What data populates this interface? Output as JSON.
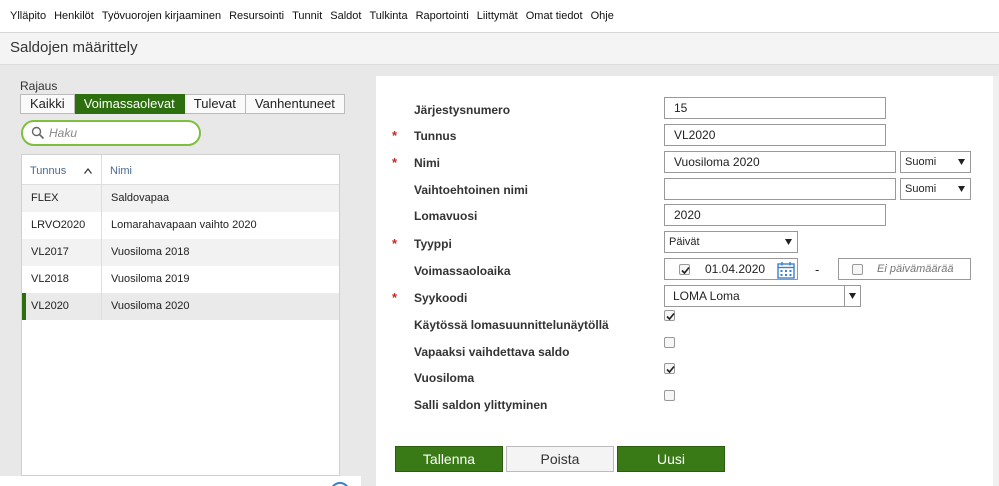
{
  "nav": [
    "Ylläpito",
    "Henkilöt",
    "Työvuorojen kirjaaminen",
    "Resursointi",
    "Tunnit",
    "Saldot",
    "Tulkinta",
    "Raportointi",
    "Liittymät",
    "Omat tiedot",
    "Ohje"
  ],
  "page": {
    "title": "Saldojen määrittely"
  },
  "filter": {
    "label": "Rajaus",
    "tabs": [
      "Kaikki",
      "Voimassaolevat",
      "Tulevat",
      "Vanhentuneet"
    ],
    "active_tab": "Voimassaolevat",
    "search_placeholder": "Haku"
  },
  "table": {
    "headers": [
      "Tunnus",
      "Nimi"
    ],
    "rows": [
      {
        "code": "FLEX",
        "name": "Saldovapaa"
      },
      {
        "code": "LRVO2020",
        "name": "Lomarahavapaan vaihto 2020"
      },
      {
        "code": "VL2017",
        "name": "Vuosiloma 2018"
      },
      {
        "code": "VL2018",
        "name": "Vuosiloma 2019"
      },
      {
        "code": "VL2020",
        "name": "Vuosiloma 2020"
      }
    ],
    "selected_row": 4
  },
  "form": {
    "jarjestysnumero_label": "Järjestysnumero",
    "jarjestysnumero_value": "15",
    "tunnus_label": "Tunnus",
    "tunnus_value": "VL2020",
    "nimi_label": "Nimi",
    "nimi_value": "Vuosiloma 2020",
    "nimi_lang": "Suomi",
    "vaihtoehtoinen_label": "Vaihtoehtoinen nimi",
    "vaihtoehtoinen_value": "",
    "vaihtoehtoinen_lang": "Suomi",
    "lomavuosi_label": "Lomavuosi",
    "lomavuosi_value": "2020",
    "tyyppi_label": "Tyyppi",
    "tyyppi_value": "Päivät",
    "voimassaolo_label": "Voimassaoloaika",
    "voimassaolo_start": "01.04.2020",
    "voimassaolo_start_checked": true,
    "voimassaolo_sep": "-",
    "voimassaolo_end_checked": false,
    "voimassaolo_end_placeholder": "Ei päivämäärää",
    "syykoodi_label": "Syykoodi",
    "syykoodi_value": "LOMA Loma",
    "lomasuunnittelu_label": "Käytössä lomasuunnittelunäytöllä",
    "lomasuunnittelu_checked": true,
    "vapaaksi_label": "Vapaaksi vaihdettava saldo",
    "vapaaksi_checked": false,
    "vuosiloma_label": "Vuosiloma",
    "vuosiloma_checked": true,
    "ylittyminen_label": "Salli saldon ylittyminen",
    "ylittyminen_checked": false,
    "required_mark": "*"
  },
  "buttons": {
    "save": "Tallenna",
    "delete": "Poista",
    "new": "Uusi"
  },
  "colors": {
    "accent": "#2d6e0f",
    "search_border": "#7fbf3f",
    "required": "#c62828",
    "calendar": "#3a7fd0"
  }
}
